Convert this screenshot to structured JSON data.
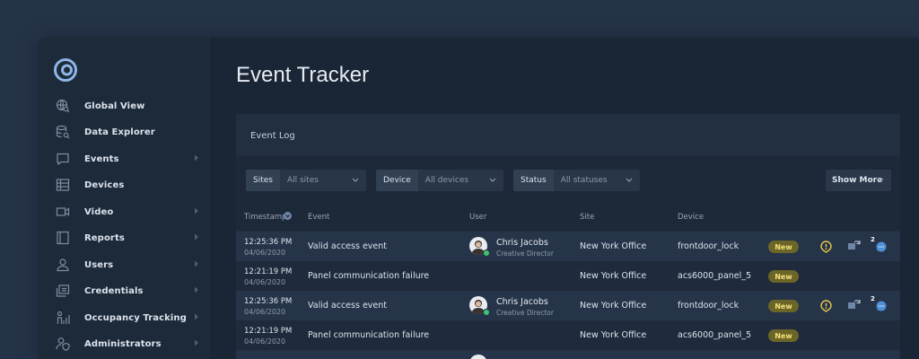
{
  "sidebar": {
    "items": [
      {
        "label": "Global View",
        "icon": "globe-search-icon",
        "has_submenu": false
      },
      {
        "label": "Data Explorer",
        "icon": "database-search-icon",
        "has_submenu": false
      },
      {
        "label": "Events",
        "icon": "message-icon",
        "has_submenu": true
      },
      {
        "label": "Devices",
        "icon": "devices-grid-icon",
        "has_submenu": false
      },
      {
        "label": "Video",
        "icon": "video-camera-icon",
        "has_submenu": true
      },
      {
        "label": "Reports",
        "icon": "reports-icon",
        "has_submenu": true
      },
      {
        "label": "Users",
        "icon": "user-icon",
        "has_submenu": true
      },
      {
        "label": "Credentials",
        "icon": "credentials-icon",
        "has_submenu": true
      },
      {
        "label": "Occupancy Tracking",
        "icon": "occupancy-icon",
        "has_submenu": true
      },
      {
        "label": "Administrators",
        "icon": "admin-icon",
        "has_submenu": true
      }
    ]
  },
  "page": {
    "title": "Event Tracker"
  },
  "panel": {
    "title": "Event Log"
  },
  "filters": [
    {
      "key": "Sites",
      "value": "All sites"
    },
    {
      "key": "Device",
      "value": "All devices"
    },
    {
      "key": "Status",
      "value": "All statuses"
    }
  ],
  "show_more": "Show More",
  "table": {
    "headers": [
      "Timestamp",
      "Event",
      "User",
      "Site",
      "Device"
    ],
    "rows": [
      {
        "time": "12:25:36 PM",
        "date": "04/06/2020",
        "event": "Valid access event",
        "user": "Chris Jacobs",
        "role": "Creative Director",
        "site": "New York Office",
        "device": "frontdoor_lock",
        "status": "New",
        "comment_count": "2"
      },
      {
        "time": "12:21:19 PM",
        "date": "04/06/2020",
        "event": "Panel communication failure",
        "user": "",
        "role": "",
        "site": "New York Office",
        "device": "acs6000_panel_5",
        "status": "New",
        "comment_count": ""
      },
      {
        "time": "12:25:36 PM",
        "date": "04/06/2020",
        "event": "Valid access event",
        "user": "Chris Jacobs",
        "role": "Creative Director",
        "site": "New York Office",
        "device": "frontdoor_lock",
        "status": "New",
        "comment_count": "2"
      },
      {
        "time": "12:21:19 PM",
        "date": "04/06/2020",
        "event": "Panel communication failure",
        "user": "",
        "role": "",
        "site": "New York Office",
        "device": "acs6000_panel_5",
        "status": "New",
        "comment_count": ""
      }
    ]
  },
  "colors": {
    "accent": "#4f8fd6",
    "badge_bg": "#6b6528",
    "badge_text": "#f4e27a",
    "warning": "#e4c64a",
    "online": "#3ec46d"
  }
}
